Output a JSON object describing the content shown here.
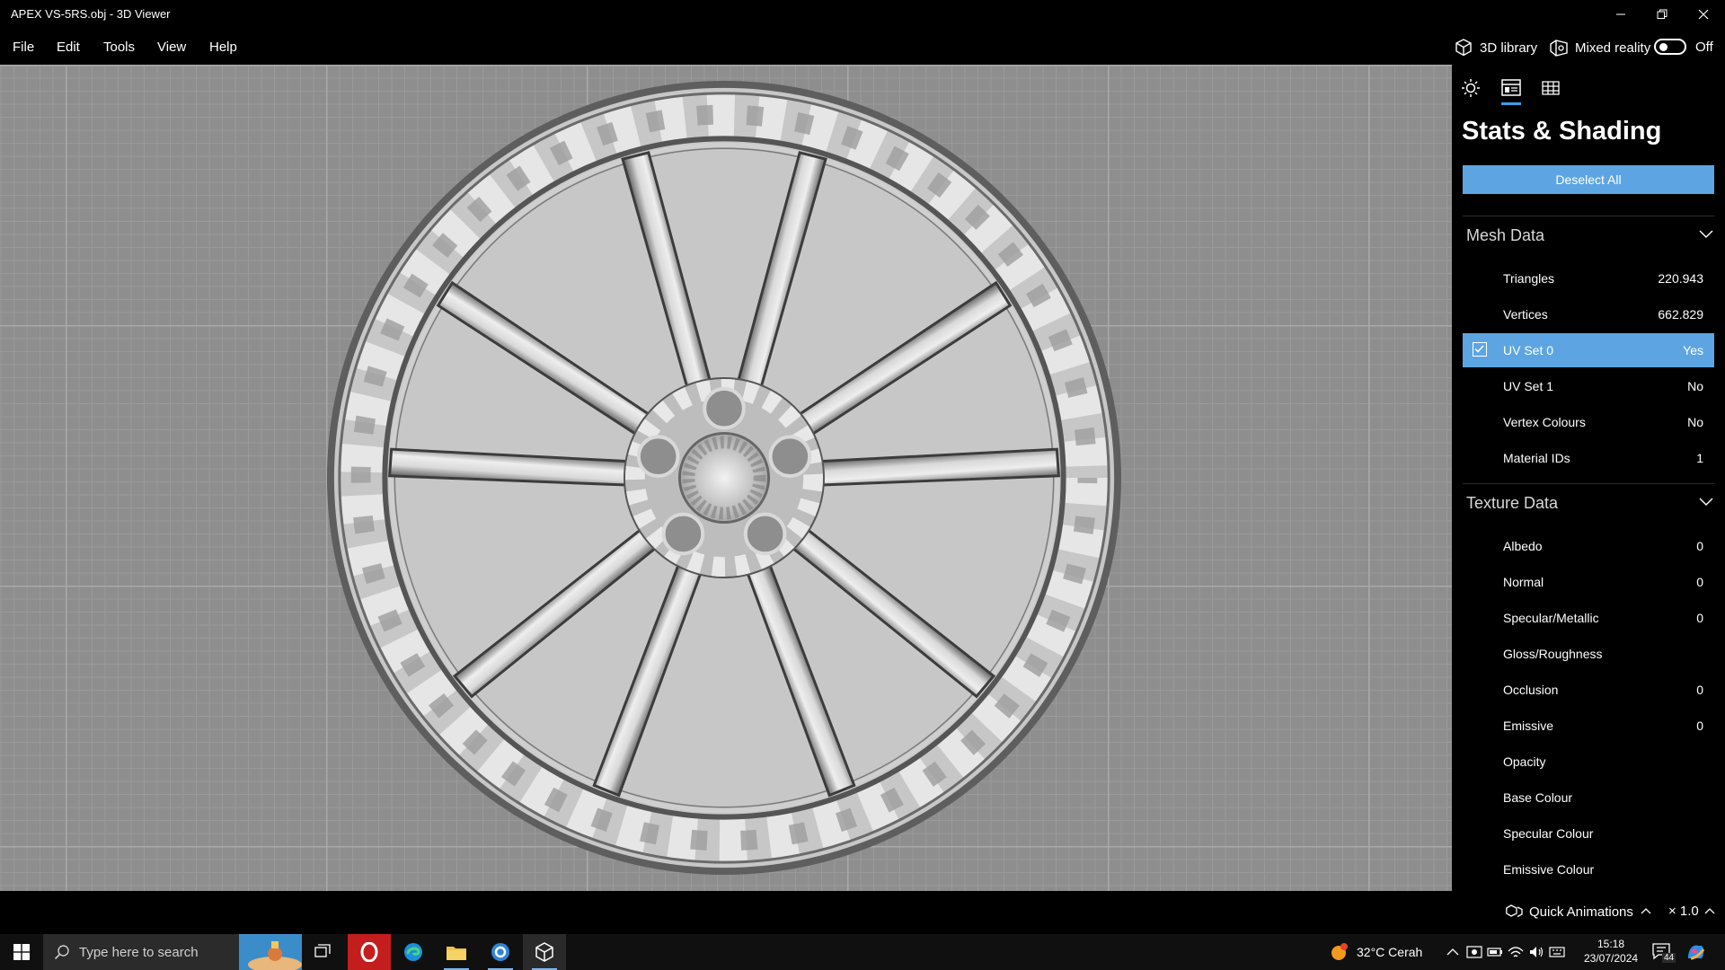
{
  "window": {
    "title": "APEX VS-5RS.obj - 3D Viewer"
  },
  "menu": {
    "file": "File",
    "edit": "Edit",
    "tools": "Tools",
    "view": "View",
    "help": "Help"
  },
  "topbar": {
    "library_label": "3D library",
    "mixed_reality_label": "Mixed reality",
    "mixed_reality_state": "Off"
  },
  "panel": {
    "tabs": {
      "active": "stats-shading",
      "icons": [
        "sun-icon",
        "stats-shading-icon",
        "grid-icon"
      ]
    },
    "title": "Stats & Shading",
    "deselect_label": "Deselect All",
    "mesh": {
      "heading": "Mesh Data",
      "rows": [
        {
          "label": "Triangles",
          "value": "220.943"
        },
        {
          "label": "Vertices",
          "value": "662.829"
        },
        {
          "label": "UV Set 0",
          "value": "Yes",
          "checked": true
        },
        {
          "label": "UV Set 1",
          "value": "No"
        },
        {
          "label": "Vertex Colours",
          "value": "No"
        },
        {
          "label": "Material IDs",
          "value": "1"
        }
      ]
    },
    "texture": {
      "heading": "Texture Data",
      "rows": [
        {
          "label": "Albedo",
          "value": "0"
        },
        {
          "label": "Normal",
          "value": "0"
        },
        {
          "label": "Specular/Metallic",
          "value": "0"
        },
        {
          "label": "Gloss/Roughness",
          "value": ""
        },
        {
          "label": "Occlusion",
          "value": "0"
        },
        {
          "label": "Emissive",
          "value": "0"
        },
        {
          "label": "Opacity",
          "value": ""
        },
        {
          "label": "Base Colour",
          "value": ""
        },
        {
          "label": "Specular Colour",
          "value": ""
        },
        {
          "label": "Emissive Colour",
          "value": ""
        }
      ]
    }
  },
  "status": {
    "quick_animations": "Quick Animations",
    "speed": "× 1.0"
  },
  "taskbar": {
    "search_placeholder": "Type here to search",
    "weather": "32°C  Cerah",
    "time": "15:18",
    "date": "23/07/2024",
    "notification_count": "44"
  },
  "colors": {
    "accent": "#5da5e2",
    "viewport_bg": "#8e8e8e",
    "panel_bg": "#000000"
  }
}
